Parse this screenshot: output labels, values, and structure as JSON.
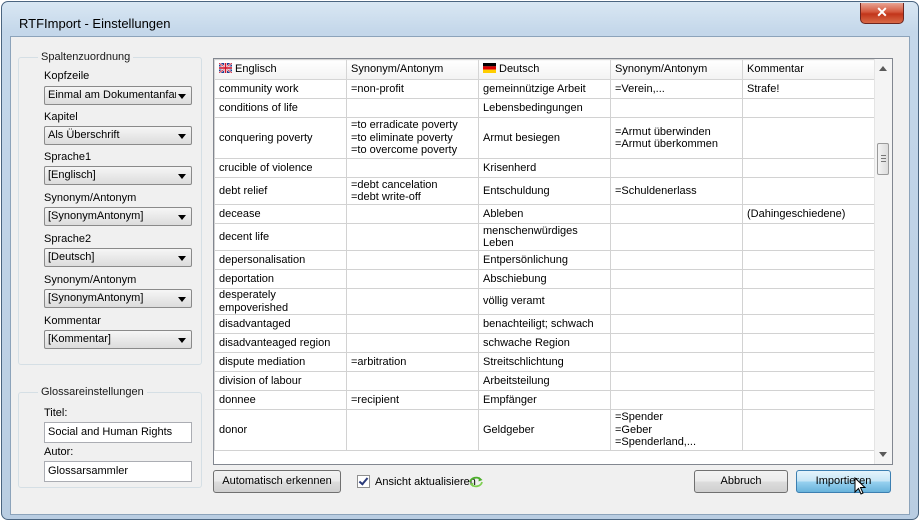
{
  "window": {
    "title": "RTFImport - Einstellungen",
    "close_symbol": "✕"
  },
  "left": {
    "group1_title": "Spaltenzuordnung",
    "fields": [
      {
        "label": "Kopfzeile",
        "value": "Einmal am Dokumentanfang"
      },
      {
        "label": "Kapitel",
        "value": "Als Überschrift"
      },
      {
        "label": "Sprache1",
        "value": "[Englisch]"
      },
      {
        "label": "Synonym/Antonym",
        "value": "[SynonymAntonym]"
      },
      {
        "label": "Sprache2",
        "value": "[Deutsch]"
      },
      {
        "label": "Synonym/Antonym",
        "value": "[SynonymAntonym]"
      },
      {
        "label": "Kommentar",
        "value": "[Kommentar]"
      }
    ],
    "group2_title": "Glossareinstellungen",
    "titel_label": "Titel:",
    "titel_value": "Social and Human Rights",
    "autor_label": "Autor:",
    "autor_value": "Glossarsammler"
  },
  "grid": {
    "columns": [
      "Englisch",
      "Synonym/Antonym",
      "Deutsch",
      "Synonym/Antonym",
      "Kommentar"
    ],
    "rows": [
      [
        "community work",
        "=non-profit",
        "gemeinnützige Arbeit",
        "=Verein,...",
        "Strafe!"
      ],
      [
        "conditions of life",
        "",
        "Lebensbedingungen",
        "",
        ""
      ],
      [
        "conquering poverty",
        "=to erradicate poverty\n=to eliminate poverty\n=to overcome poverty",
        "Armut besiegen",
        "=Armut überwinden\n=Armut überkommen",
        ""
      ],
      [
        "crucible of violence",
        "",
        "Krisenherd",
        "",
        ""
      ],
      [
        "debt relief",
        "=debt cancelation\n=debt write-off",
        "Entschuldung",
        "=Schuldenerlass",
        ""
      ],
      [
        "decease",
        "",
        "Ableben",
        "",
        "(Dahingeschiedene)"
      ],
      [
        "decent life",
        "",
        "menschenwürdiges\nLeben",
        "",
        ""
      ],
      [
        "depersonalisation",
        "",
        "Entpersönlichung",
        "",
        ""
      ],
      [
        "deportation",
        "",
        "Abschiebung",
        "",
        ""
      ],
      [
        "desperately empoverished",
        "",
        "völlig veramt",
        "",
        ""
      ],
      [
        "disadvantaged",
        "",
        "benachteiligt; schwach",
        "",
        ""
      ],
      [
        "disadvanteaged region",
        "",
        "schwache Region",
        "",
        ""
      ],
      [
        "dispute mediation",
        "=arbitration",
        "Streitschlichtung",
        "",
        ""
      ],
      [
        "division of labour",
        "",
        "Arbeitsteilung",
        "",
        ""
      ],
      [
        "donnee",
        "=recipient",
        "Empfänger",
        "",
        ""
      ],
      [
        "donor",
        "",
        "Geldgeber",
        "=Spender\n=Geber\n=Spenderland,...",
        ""
      ]
    ]
  },
  "bottom": {
    "auto_button": "Automatisch erkennen",
    "refresh_checkbox_label": "Ansicht aktualisieren",
    "refresh_checked": true,
    "cancel_button": "Abbruch",
    "import_button": "Importieren"
  }
}
